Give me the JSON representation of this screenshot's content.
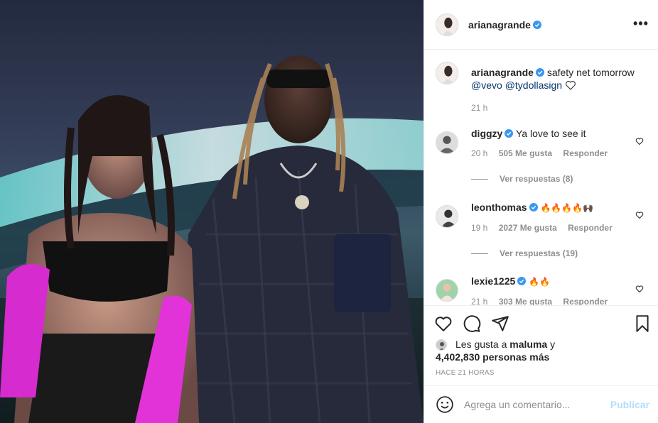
{
  "post": {
    "author": "arianagrande",
    "more_label": "•••"
  },
  "caption": {
    "author": "arianagrande",
    "text": "safety net tomorrow",
    "mention1": "@vevo",
    "mention2": "@tydollasign",
    "time": "21 h"
  },
  "comments": [
    {
      "user": "diggzy",
      "text": "Ya love to see it",
      "time": "20 h",
      "likes": "505 Me gusta",
      "reply": "Responder",
      "view_replies": "Ver respuestas (8)"
    },
    {
      "user": "leonthomas",
      "text": "🔥🔥🔥🔥🙌🏿",
      "time": "19 h",
      "likes": "2027 Me gusta",
      "reply": "Responder",
      "view_replies": "Ver respuestas (19)"
    },
    {
      "user": "lexie1225",
      "text": "🔥🔥",
      "time": "21 h",
      "likes": "303 Me gusta",
      "reply": "Responder"
    }
  ],
  "likes": {
    "prefix": "Les gusta a",
    "user": "maluma",
    "joiner": "y",
    "count": "4,402,830 personas más"
  },
  "timestamp": "HACE 21 HORAS",
  "add_comment": {
    "placeholder": "Agrega un comentario...",
    "publish": "Publicar"
  },
  "colors": {
    "verified": "#3897f0",
    "link": "#00376b",
    "muted": "#8e8e8e",
    "publish": "#b2dffc"
  }
}
